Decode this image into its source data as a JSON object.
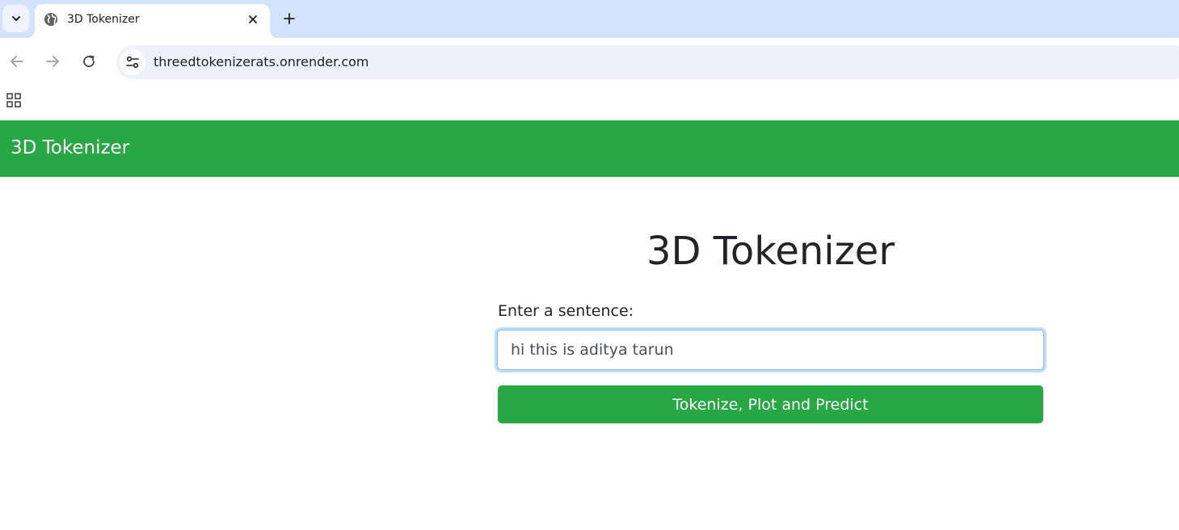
{
  "browser": {
    "tab": {
      "title": "3D Tokenizer"
    },
    "address_bar": {
      "url": "threedtokenizerats.onrender.com"
    }
  },
  "page": {
    "navbar": {
      "brand": "3D Tokenizer"
    },
    "heading": "3D Tokenizer",
    "form": {
      "label": "Enter a sentence:",
      "input_value": "hi this is aditya tarun",
      "submit_label": "Tokenize, Plot and Predict"
    }
  },
  "colors": {
    "brand_green": "#28a745",
    "tabstrip": "#d3e3fd",
    "omnibox": "#edf2fa",
    "focus_border": "#80bdff"
  }
}
